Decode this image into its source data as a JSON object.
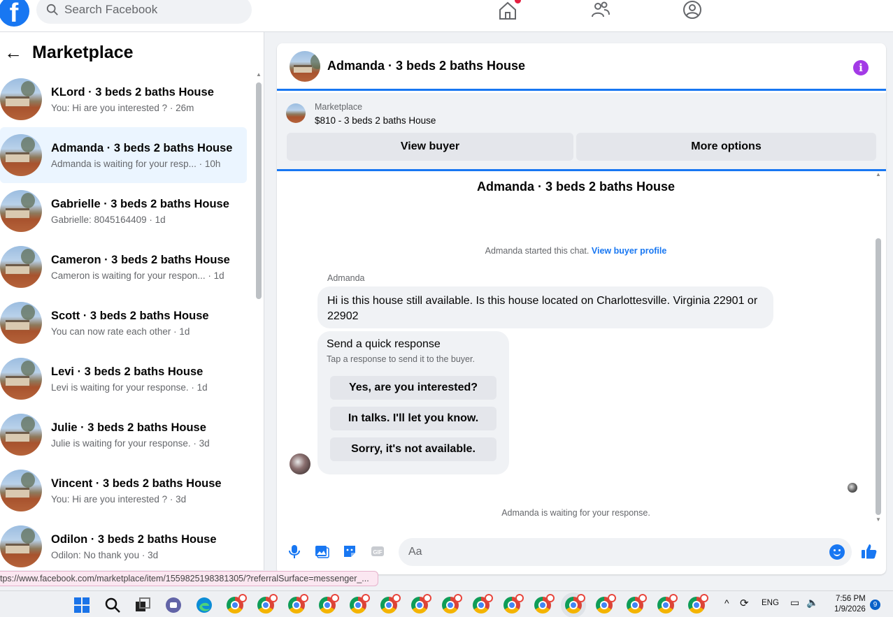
{
  "topbar": {
    "logo": "f",
    "search_placeholder": "Search Facebook",
    "nav_icons": [
      "home-icon",
      "friends-icon",
      "profile-icon"
    ]
  },
  "sidebar": {
    "back": "←",
    "title": "Marketplace",
    "conversations": [
      {
        "title": "KLord · 3 beds 2 baths House",
        "subtitle": "You: Hi are you interested ? · 26m"
      },
      {
        "title": "Admanda · 3 beds 2 baths House",
        "subtitle": "Admanda is waiting for your resp... · 10h"
      },
      {
        "title": "Gabrielle · 3 beds 2 baths House",
        "subtitle": "Gabrielle: 8045164409 · 1d"
      },
      {
        "title": "Cameron · 3 beds 2 baths House",
        "subtitle": "Cameron is waiting for your respon... · 1d"
      },
      {
        "title": "Scott · 3 beds 2 baths House",
        "subtitle": "You can now rate each other · 1d"
      },
      {
        "title": "Levi · 3 beds 2 baths House",
        "subtitle": "Levi is waiting for your response. · 1d"
      },
      {
        "title": "Julie · 3 beds 2 baths House",
        "subtitle": "Julie is waiting for your response. · 3d"
      },
      {
        "title": "Vincent · 3 beds 2 baths House",
        "subtitle": "You: Hi are you interested ? · 3d"
      },
      {
        "title": "Odilon · 3 beds 2 baths House",
        "subtitle": "Odilon: No thank you · 3d"
      }
    ]
  },
  "chat": {
    "header_title": "Admanda · 3 beds 2 baths House",
    "listing_source": "Marketplace",
    "listing_price_title": "$810 - 3 beds 2 baths House",
    "view_buyer": "View buyer",
    "more_options": "More options",
    "body_title": "Admanda · 3 beds 2 baths House",
    "started_text": "Admanda started this chat.",
    "view_buyer_profile": "View buyer profile",
    "sender_name": "Admanda",
    "message": "Hi is this house still available. Is this house located on Charlottesville. Virginia 22901 or 22902",
    "quick_title": "Send a quick response",
    "quick_subtitle": "Tap a response to send it to the buyer.",
    "quick_options": [
      "Yes, are you interested?",
      "In talks. I'll let you know.",
      "Sorry, it's not available."
    ],
    "waiting_text": "Admanda is waiting for your response.",
    "input_placeholder": "Aa"
  },
  "status_url": "tps://www.facebook.com/marketplace/item/1559825198381305/?referralSurface=messenger_...",
  "taskbar": {
    "language": "ENG",
    "time": "7:56 PM",
    "date": "1/9/2026",
    "notifications": "9"
  },
  "colors": {
    "brand_blue": "#1877f2",
    "info_purple": "#a33ae6"
  }
}
